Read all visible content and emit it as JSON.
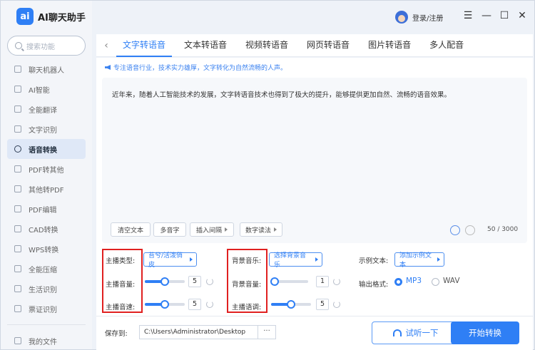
{
  "brand": {
    "logo": "ai",
    "name": "AI聊天助手"
  },
  "search": {
    "placeholder": "搜索功能"
  },
  "nav": {
    "items": [
      {
        "label": "聊天机器人",
        "icon": "robot-icon"
      },
      {
        "label": "AI智能",
        "icon": "ai-icon"
      },
      {
        "label": "全能翻译",
        "icon": "translate-icon"
      },
      {
        "label": "文字识别",
        "icon": "ocr-icon"
      },
      {
        "label": "语音转换",
        "icon": "voice-icon",
        "active": true
      },
      {
        "label": "PDF转其他",
        "icon": "pdf-icon"
      },
      {
        "label": "其他转PDF",
        "icon": "to-pdf-icon"
      },
      {
        "label": "PDF编辑",
        "icon": "pdf-edit-icon"
      },
      {
        "label": "CAD转换",
        "icon": "cad-icon"
      },
      {
        "label": "WPS转换",
        "icon": "wps-icon"
      },
      {
        "label": "全能压缩",
        "icon": "compress-icon"
      },
      {
        "label": "生活识别",
        "icon": "life-icon"
      },
      {
        "label": "票证识别",
        "icon": "ticket-icon"
      }
    ],
    "my_files": "我的文件"
  },
  "header": {
    "user_label": "登录/注册",
    "menu": "☰",
    "minimize": "—",
    "maximize": "☐",
    "close": "✕"
  },
  "tabs": [
    {
      "label": "文字转语音",
      "active": true
    },
    {
      "label": "文本转语音"
    },
    {
      "label": "视频转语音"
    },
    {
      "label": "网页转语音"
    },
    {
      "label": "图片转语音"
    },
    {
      "label": "多人配音"
    }
  ],
  "banner": "专注语音行业，技术实力雄厚，文字转化为自然流畅的人声。",
  "editor": {
    "text": "近年来，随着人工智能技术的发展，文字转语音技术也得到了极大的提升，能够提供更加自然、流畅的语音效果。",
    "buttons": {
      "clear": "清空文本",
      "polyphone": "多音字",
      "pause": "插入间隔",
      "number": "数字读法"
    },
    "counter": "50 / 3000"
  },
  "settings": {
    "anchor_type_label": "主播类型:",
    "anchor_type_value": "苔兮/活泼俏皮",
    "anchor_volume_label": "主播音量:",
    "anchor_volume_value": "5",
    "anchor_volume_level": 0.5,
    "anchor_speed_label": "主播音速:",
    "anchor_speed_value": "5",
    "anchor_speed_level": 0.5,
    "bg_music_label": "背景音乐:",
    "bg_music_value": "选择背景音乐",
    "bg_volume_label": "背景音量:",
    "bg_volume_value": "1",
    "bg_volume_level": 0.1,
    "anchor_pitch_label": "主播语调:",
    "anchor_pitch_value": "5",
    "anchor_pitch_level": 0.5,
    "example_label": "示例文本:",
    "example_value": "添加示例文本",
    "format_label": "输出格式:",
    "format_mp3": "MP3",
    "format_wav": "WAV",
    "selected_format": "MP3"
  },
  "bottom": {
    "save_label": "保存到:",
    "save_path": "C:\\Users\\Administrator\\Desktop",
    "browse": "···",
    "try_label": "试听一下",
    "start_label": "开始转换"
  },
  "colors": {
    "accent": "#2f7ff5",
    "highlight_box": "#e02020"
  }
}
